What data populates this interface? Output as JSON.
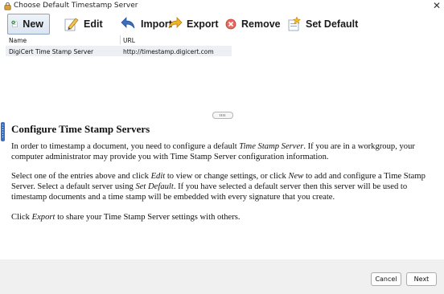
{
  "window": {
    "title": "Choose Default Timestamp Server",
    "close_glyph": "✕"
  },
  "toolbar": {
    "new_label": "New",
    "edit_label": "Edit",
    "import_label": "Import",
    "export_label": "Export",
    "remove_label": "Remove",
    "set_default_label": "Set Default"
  },
  "table": {
    "columns": [
      "Name",
      "URL"
    ],
    "rows": [
      {
        "name": "DigiCert Time Stamp Server",
        "url": "http://timestamp.digicert.com"
      }
    ]
  },
  "help": {
    "heading": "Configure Time Stamp Servers",
    "p1_a": "In order to timestamp a document, you need to configure a default ",
    "p1_em": "Time Stamp Server",
    "p1_b": ". If you are in a workgroup, your computer administrator may provide you with Time Stamp Server configuration information.",
    "p2_a": "Select one of the entries above and click ",
    "p2_em1": "Edit",
    "p2_b": " to view or change settings, or click ",
    "p2_em2": "New",
    "p2_c": " to add and configure a Time Stamp Server. Select a default server using ",
    "p2_em3": "Set Default",
    "p2_d": ". If you have selected a default server then this server will be used to timestamp documents and a time stamp will be embedded with every signature that you create.",
    "p3_a": "Click ",
    "p3_em": "Export",
    "p3_b": " to share your Time Stamp Server settings with others."
  },
  "footer": {
    "cancel_label": "Cancel",
    "next_label": "Next"
  }
}
